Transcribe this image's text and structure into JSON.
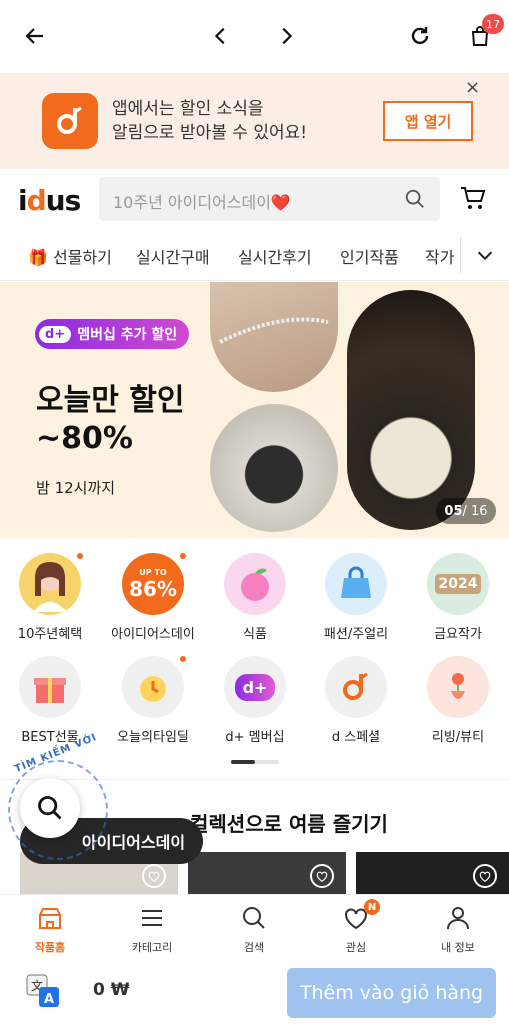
{
  "topbar": {
    "cart_count": "17"
  },
  "promo": {
    "line1": "앱에서는 할인 소식을",
    "line2": "알림으로 받아볼 수 있어요!",
    "button": "앱 열기",
    "close": "×"
  },
  "header": {
    "logo": "idus",
    "search_placeholder": "10주년 아이디어스데이❤️"
  },
  "tabs": [
    "🎁 선물하기",
    "실시간구매",
    "실시간후기",
    "인기작품",
    "작가"
  ],
  "banner": {
    "badge_prefix": "d+",
    "badge": "멤버십 추가 할인",
    "title1": "오늘만 할인",
    "title2": "~80%",
    "subtitle": "밤 12시까지",
    "counter_current": "05",
    "counter_total": " / 16"
  },
  "categories": [
    {
      "label": "10주년혜택"
    },
    {
      "label": "아이디어스데이",
      "badge_top": "UP TO",
      "badge_main": "86%"
    },
    {
      "label": "식품"
    },
    {
      "label": "패션/주얼리"
    },
    {
      "label": "금요작가",
      "badge_main": "2024"
    },
    {
      "label": "BEST선물"
    },
    {
      "label": "오늘의타임딜"
    },
    {
      "label": "d+ 멤버십",
      "badge_main": "d+"
    },
    {
      "label": "d 스페셜"
    },
    {
      "label": "리빙/뷰티"
    }
  ],
  "section": {
    "title": "컬렉션으로 여름 즐기기"
  },
  "floating": {
    "ring_text": "TÌM KIẾM VỚI",
    "chip": "아이디어스데이"
  },
  "bottomnav": [
    {
      "label": "작품홈",
      "active": true
    },
    {
      "label": "카테고리"
    },
    {
      "label": "검색"
    },
    {
      "label": "관심",
      "badge": "N"
    },
    {
      "label": "내 정보"
    }
  ],
  "footer": {
    "price": "0 ₩",
    "add_to_cart": "Thêm vào giỏ hàng"
  },
  "colors": {
    "accent": "#f26a1b",
    "promo_bg": "#fbeee7",
    "banner_bg": "#fdf1df",
    "cart_button": "#9ec3ef"
  }
}
